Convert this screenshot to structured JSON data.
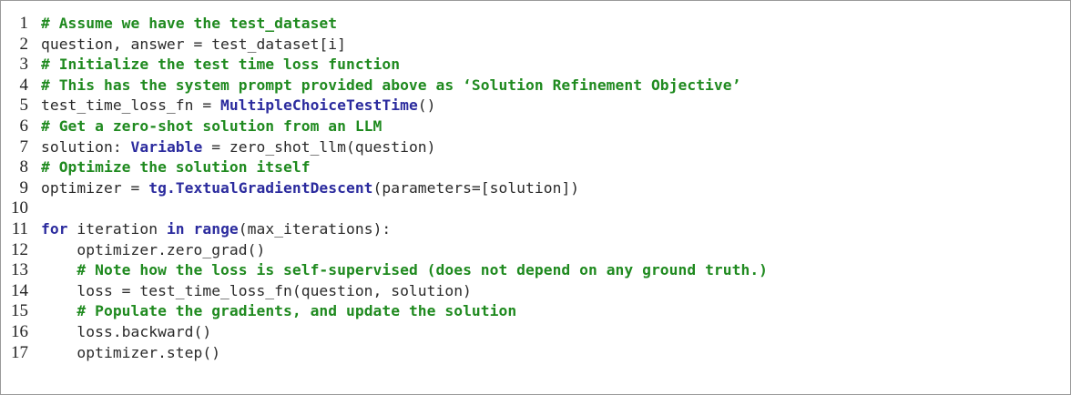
{
  "colors": {
    "comment": "#1f8a1f",
    "keyword": "#2b2b9e",
    "text": "#2a2a2a",
    "border": "#9a9a9a",
    "background": "#ffffff"
  },
  "code": {
    "lines": [
      {
        "number": "1",
        "tokens": [
          {
            "type": "comment",
            "text": "# Assume we have the test_dataset"
          }
        ]
      },
      {
        "number": "2",
        "tokens": [
          {
            "type": "plain",
            "text": "question, answer = test_dataset[i]"
          }
        ]
      },
      {
        "number": "3",
        "tokens": [
          {
            "type": "comment",
            "text": "# Initialize the test time loss function"
          }
        ]
      },
      {
        "number": "4",
        "tokens": [
          {
            "type": "comment",
            "text": "# This has the system prompt provided above as ‘Solution Refinement Objective’"
          }
        ]
      },
      {
        "number": "5",
        "tokens": [
          {
            "type": "plain",
            "text": "test_time_loss_fn = "
          },
          {
            "type": "class",
            "text": "MultipleChoiceTestTime"
          },
          {
            "type": "plain",
            "text": "()"
          }
        ]
      },
      {
        "number": "6",
        "tokens": [
          {
            "type": "comment",
            "text": "# Get a zero-shot solution from an LLM"
          }
        ]
      },
      {
        "number": "7",
        "tokens": [
          {
            "type": "plain",
            "text": "solution: "
          },
          {
            "type": "class",
            "text": "Variable"
          },
          {
            "type": "plain",
            "text": " = zero_shot_llm(question)"
          }
        ]
      },
      {
        "number": "8",
        "tokens": [
          {
            "type": "comment",
            "text": "# Optimize the solution itself"
          }
        ]
      },
      {
        "number": "9",
        "tokens": [
          {
            "type": "plain",
            "text": "optimizer = "
          },
          {
            "type": "class",
            "text": "tg.TextualGradientDescent"
          },
          {
            "type": "plain",
            "text": "(parameters=[solution])"
          }
        ]
      },
      {
        "number": "10",
        "tokens": []
      },
      {
        "number": "11",
        "tokens": [
          {
            "type": "keyword",
            "text": "for"
          },
          {
            "type": "plain",
            "text": " iteration "
          },
          {
            "type": "keyword",
            "text": "in"
          },
          {
            "type": "plain",
            "text": " "
          },
          {
            "type": "keyword",
            "text": "range"
          },
          {
            "type": "plain",
            "text": "(max_iterations):"
          }
        ]
      },
      {
        "number": "12",
        "tokens": [
          {
            "type": "plain",
            "text": "    optimizer.zero_grad()"
          }
        ]
      },
      {
        "number": "13",
        "tokens": [
          {
            "type": "plain",
            "text": "    "
          },
          {
            "type": "comment",
            "text": "# Note how the loss is self-supervised (does not depend on any ground truth.)"
          }
        ]
      },
      {
        "number": "14",
        "tokens": [
          {
            "type": "plain",
            "text": "    loss = test_time_loss_fn(question, solution)"
          }
        ]
      },
      {
        "number": "15",
        "tokens": [
          {
            "type": "plain",
            "text": "    "
          },
          {
            "type": "comment",
            "text": "# Populate the gradients, and update the solution"
          }
        ]
      },
      {
        "number": "16",
        "tokens": [
          {
            "type": "plain",
            "text": "    loss.backward()"
          }
        ]
      },
      {
        "number": "17",
        "tokens": [
          {
            "type": "plain",
            "text": "    optimizer.step()"
          }
        ]
      }
    ]
  }
}
